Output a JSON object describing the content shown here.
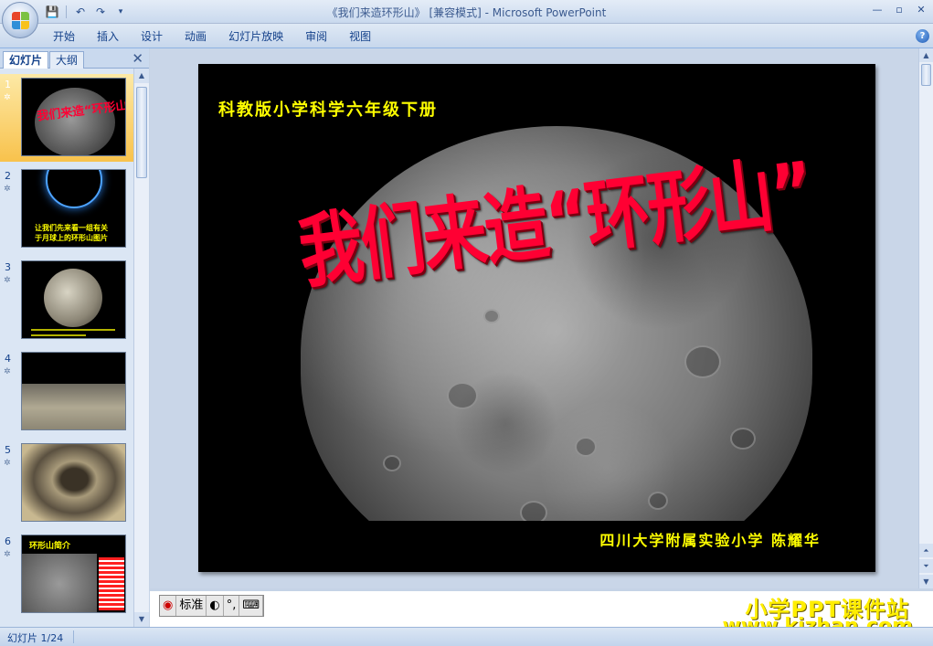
{
  "window": {
    "title": "《我们来造环形山》 [兼容模式] - Microsoft PowerPoint",
    "controls": [
      "—",
      "▫",
      "✕"
    ]
  },
  "quick_access": {
    "save_icon": "save-icon",
    "undo_icon": "undo-icon",
    "redo_icon": "redo-icon"
  },
  "ribbon": {
    "tabs": [
      "开始",
      "插入",
      "设计",
      "动画",
      "幻灯片放映",
      "审阅",
      "视图"
    ],
    "help": "?"
  },
  "left_panel": {
    "tabs": [
      "幻灯片",
      "大纲"
    ],
    "close": "✕",
    "slides": [
      {
        "num": "1",
        "caption": "我们来造“环形山”",
        "selected": true
      },
      {
        "num": "2",
        "caption_line1": "让我们先来看一组有关",
        "caption_line2": "于月球上的环形山图片"
      },
      {
        "num": "3"
      },
      {
        "num": "4"
      },
      {
        "num": "5"
      },
      {
        "num": "6",
        "caption": "环形山简介"
      }
    ]
  },
  "slide": {
    "subject": "科教版小学科学六年级下册",
    "title": "我们来造“环形山”",
    "author": "四川大学附属实验小学 陈耀华"
  },
  "ime": {
    "mode": "标准"
  },
  "watermark": {
    "line1": "小学PPT课件站",
    "line2": "www.kjzhan.com"
  },
  "status": {
    "slide_counter": "幻灯片 1/24"
  }
}
